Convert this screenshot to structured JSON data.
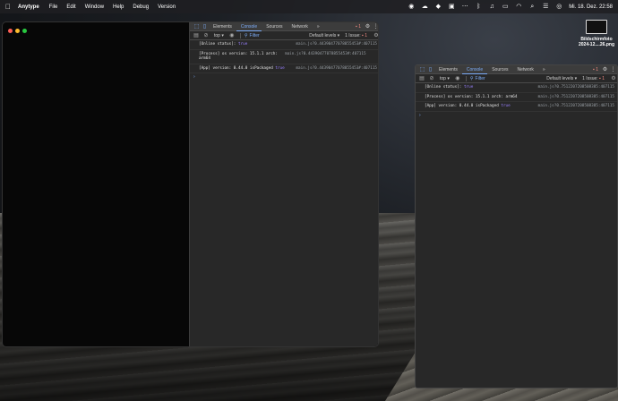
{
  "menubar": {
    "app_name": "Anytype",
    "items": [
      "File",
      "Edit",
      "Window",
      "Help",
      "Debug",
      "Version"
    ],
    "clock": "Mi. 18. Dez.  22:58"
  },
  "desktop_file": {
    "name_line1": "Bildschirmfoto",
    "name_line2": "2024-12....26.png"
  },
  "devtools": {
    "tabs": [
      "Elements",
      "Console",
      "Sources",
      "Network"
    ],
    "active_tab": "Console",
    "more_tabs": "»",
    "badge_count": "1",
    "context": "top",
    "filter_placeholder": "Filter",
    "levels": "Default levels",
    "issues_label": "1 Issue:",
    "issues_count": "1",
    "accent_color": "#7cacf8",
    "error_color": "#f28b82"
  },
  "console1": {
    "lines": [
      {
        "text_a": "[Online status]: ",
        "text_b": "true",
        "src": "main.js?0.44390477078855453#:407115"
      },
      {
        "text_a": "[Process] os version: 15.1.1 arch: arm64",
        "text_b": "",
        "src": "main.js?0.44390477078855453#:407115"
      },
      {
        "text_a": "[App] version: 0.44.0 isPackaged ",
        "text_b": "true",
        "src": "main.js?0.44390477078855453#:407115"
      }
    ]
  },
  "console2": {
    "lines": [
      {
        "text_a": "[Online status]: ",
        "text_b": "true",
        "src": "main.js?0.7512207208508385:407115"
      },
      {
        "text_a": "[Process] os version: 15.1.1 arch: arm64",
        "text_b": "",
        "src": "main.js?0.7512207208508385:407115"
      },
      {
        "text_a": "[App] version: 0.44.0 isPackaged ",
        "text_b": "true",
        "src": "main.js?0.7512207208508385:407115"
      }
    ]
  }
}
